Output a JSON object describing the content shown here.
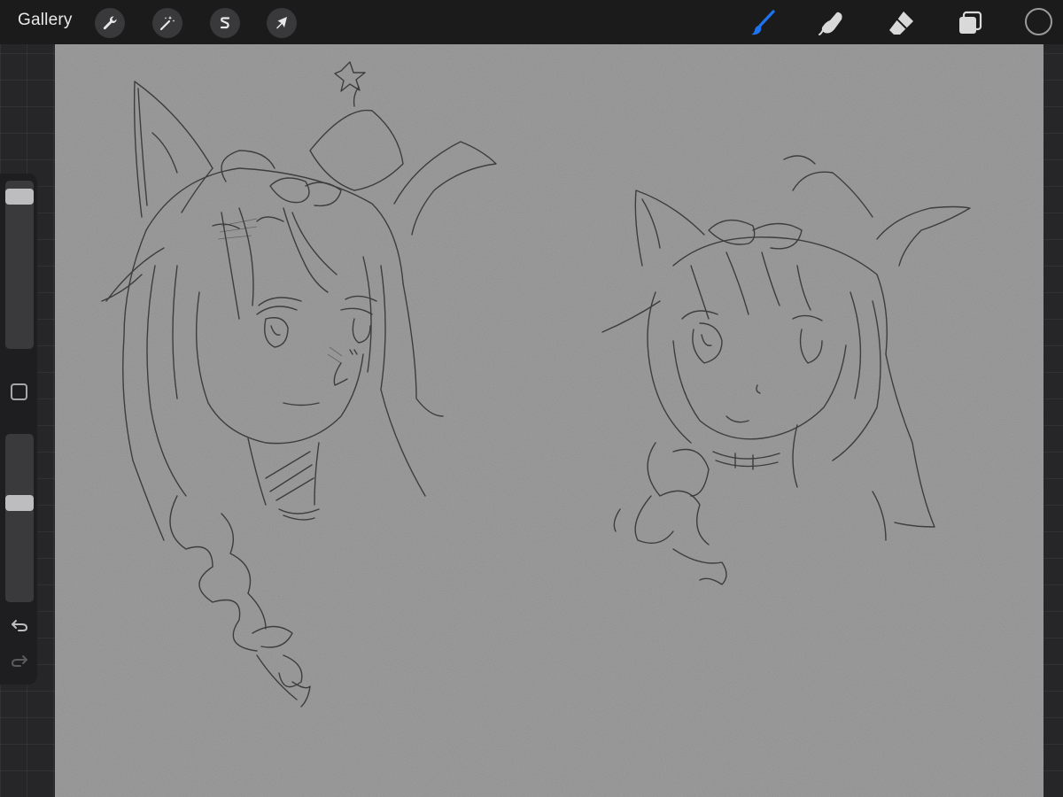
{
  "toolbar": {
    "gallery_label": "Gallery",
    "left_tools": [
      {
        "name": "actions",
        "icon": "wrench-icon"
      },
      {
        "name": "adjustments",
        "icon": "magic-wand-icon"
      },
      {
        "name": "selection",
        "icon": "selection-s-icon"
      },
      {
        "name": "transform",
        "icon": "arrow-cursor-icon"
      }
    ],
    "right_tools": [
      {
        "name": "brush",
        "icon": "brush-icon",
        "active": true
      },
      {
        "name": "smudge",
        "icon": "smudge-finger-icon",
        "active": false
      },
      {
        "name": "eraser",
        "icon": "eraser-icon",
        "active": false
      },
      {
        "name": "layers",
        "icon": "layers-icon",
        "active": false
      }
    ],
    "active_color": "#1b1b1c",
    "accent_color": "#1e74f0"
  },
  "sidebar": {
    "brush_size_level": 0.95,
    "opacity_level": 0.6,
    "modify_icon": "square-modify-icon",
    "undo_icon": "undo-arrow-icon",
    "redo_icon": "redo-arrow-icon"
  },
  "canvas": {
    "paper_color": "#8f8f8f",
    "content": "pencil-sketch-two-cat-eared-girls"
  }
}
